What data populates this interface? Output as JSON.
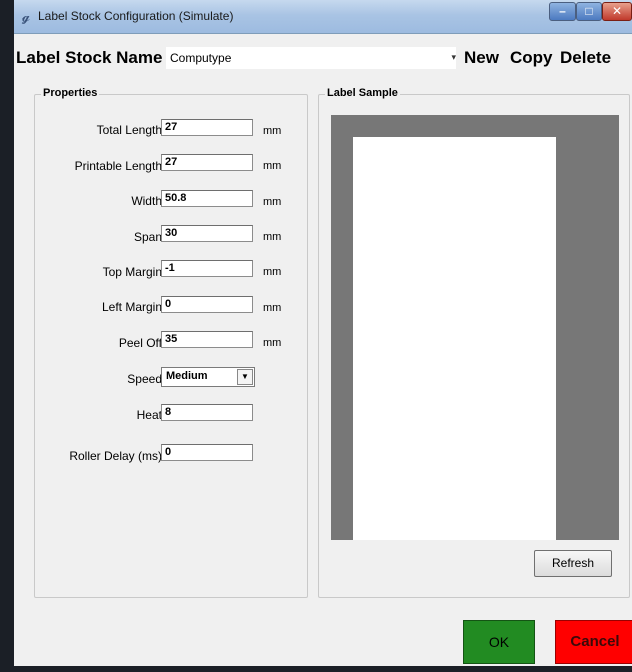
{
  "window": {
    "title": "Label Stock Configuration (Simulate)",
    "icon": "label-config-icon"
  },
  "toolbar": {
    "stock_name_label": "Label Stock Name",
    "stock_name_value": "Computype",
    "new_label": "New",
    "copy_label": "Copy",
    "delete_label": "Delete"
  },
  "properties": {
    "title": "Properties",
    "total_length": {
      "label": "Total Length",
      "value": "27",
      "unit": "mm"
    },
    "printable_length": {
      "label": "Printable Length",
      "value": "27",
      "unit": "mm"
    },
    "width": {
      "label": "Width",
      "value": "50.8",
      "unit": "mm"
    },
    "span": {
      "label": "Span",
      "value": "30",
      "unit": "mm"
    },
    "top_margin": {
      "label": "Top Margin",
      "value": "-1",
      "unit": "mm"
    },
    "left_margin": {
      "label": "Left Margin",
      "value": "0",
      "unit": "mm"
    },
    "peel_off": {
      "label": "Peel Off",
      "value": "35",
      "unit": "mm"
    },
    "speed": {
      "label": "Speed",
      "value": "Medium"
    },
    "heat": {
      "label": "Heat",
      "value": "8"
    },
    "roller_delay": {
      "label": "Roller Delay (ms)",
      "value": "0"
    }
  },
  "sample": {
    "title": "Label Sample",
    "refresh_label": "Refresh"
  },
  "footer": {
    "ok_label": "OK",
    "cancel_label": "Cancel"
  },
  "colors": {
    "ok": "#228b22",
    "cancel": "#ff0000",
    "canvas": "#777777"
  }
}
